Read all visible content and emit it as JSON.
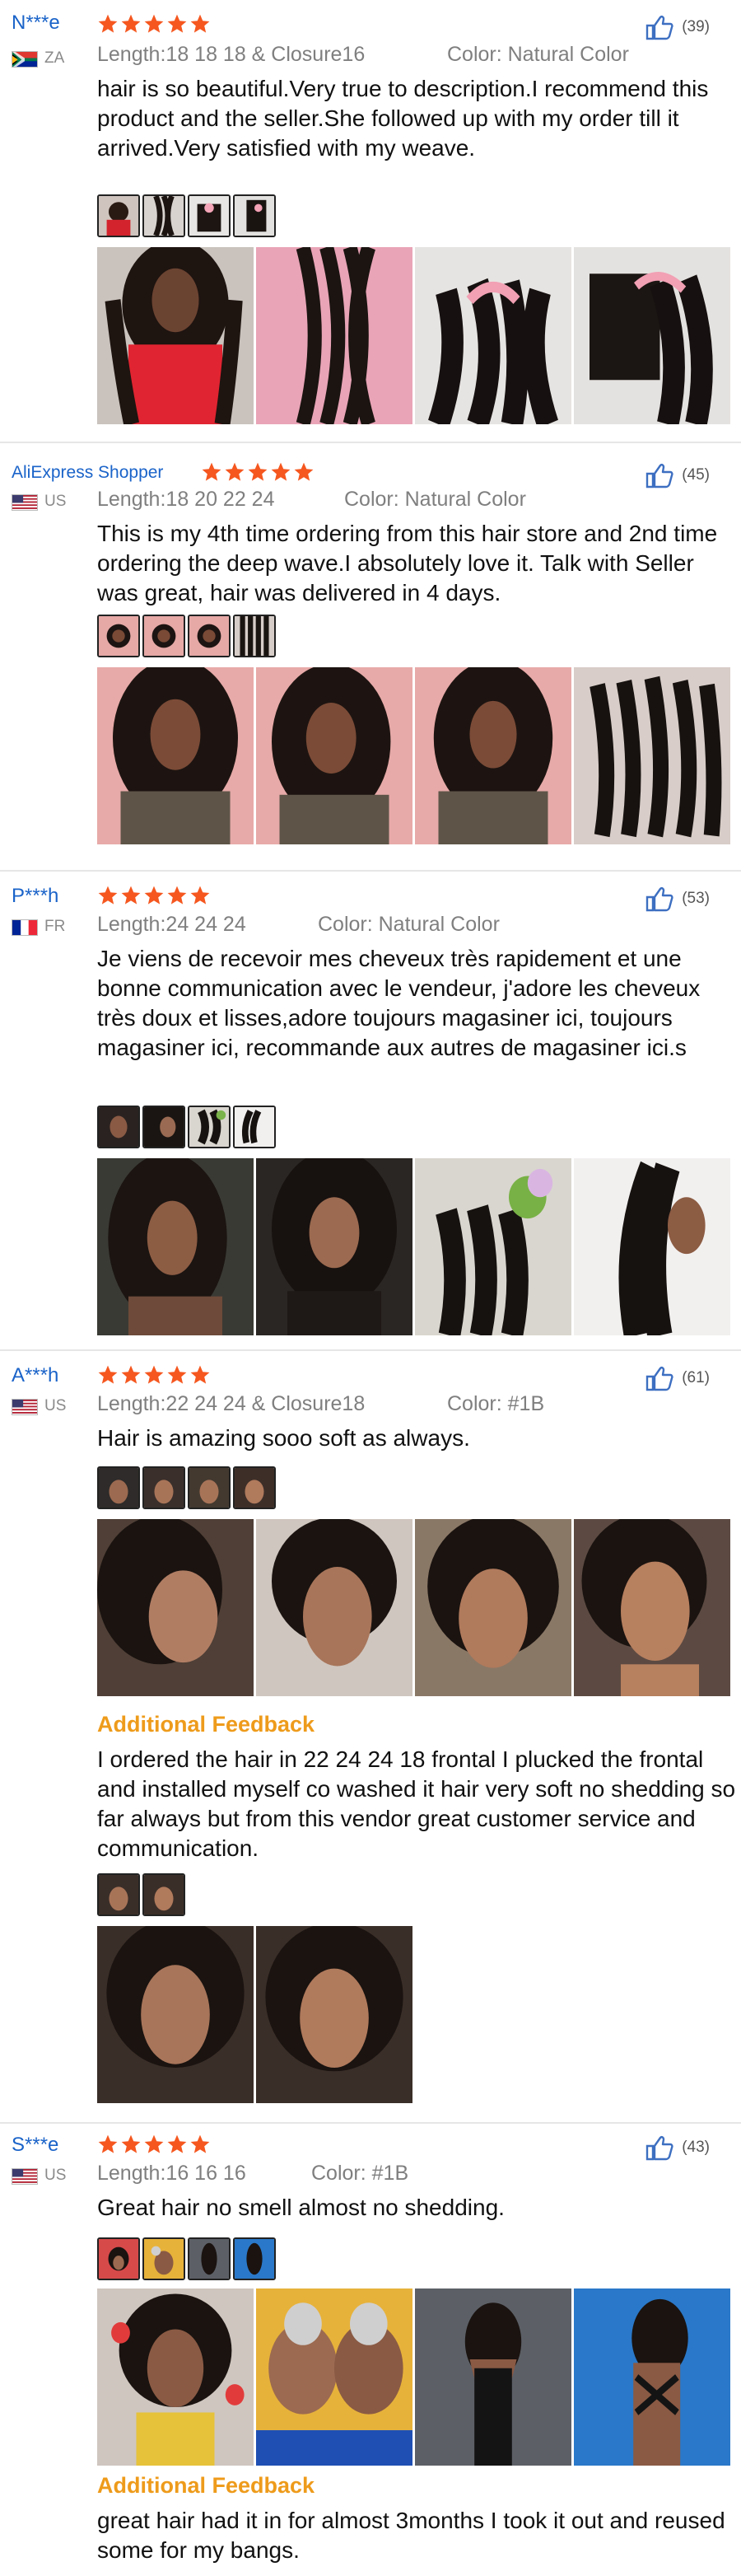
{
  "reviews": [
    {
      "user": "N***e",
      "country": "ZA",
      "likes": "(39)",
      "length": "Length:18 18 18 & Closure16",
      "color": "Color: Natural Color",
      "text": "hair is so beautiful.Very true to description.I recommend this product and the seller.She followed up with my order till it arrived.Very satisfied with my weave.",
      "rating": 5
    },
    {
      "user": "AliExpress Shopper",
      "country": "US",
      "likes": "(45)",
      "length": "Length:18 20 22 24",
      "color": "Color: Natural Color",
      "text": "This is my 4th time ordering from this hair store and 2nd time ordering the deep wave.I absolutely love it. Talk with Seller was great, hair was delivered in 4 days.",
      "rating": 5
    },
    {
      "user": "P***h",
      "country": "FR",
      "likes": "(53)",
      "length": "Length:24 24 24",
      "color": "Color: Natural Color",
      "text": "Je viens de recevoir mes cheveux très rapidement et une bonne communication avec le vendeur, j'adore les cheveux très doux et lisses,adore toujours magasiner ici, toujours magasiner ici, recommande aux autres de magasiner ici.s",
      "rating": 5
    },
    {
      "user": "A***h",
      "country": "US",
      "likes": "(61)",
      "length": "Length:22 24 24 & Closure18",
      "color": "Color: #1B",
      "text": "Hair is amazing sooo soft as always.",
      "additional_label": "Additional Feedback",
      "additional_text": "I ordered the hair in 22 24 24 18 frontal I plucked the frontal and installed myself co washed it hair very soft no shedding so far always but from this vendor great customer service and communication.",
      "rating": 5
    },
    {
      "user": "S***e",
      "country": "US",
      "likes": "(43)",
      "length": "Length:16 16 16",
      "color": "Color: #1B",
      "text": "Great hair no smell almost no shedding.",
      "additional_label": "Additional Feedback",
      "additional_text": "great hair had it in for almost 3months I took it out and reused some for my bangs.",
      "rating": 5
    }
  ],
  "colors": {
    "star": "#f5571f",
    "username": "#1a63c9",
    "additional": "#ee9b1b",
    "meta": "#7f7f7f"
  },
  "icons": [
    "star-icon",
    "thumbs-up-icon",
    "flag-icon"
  ]
}
